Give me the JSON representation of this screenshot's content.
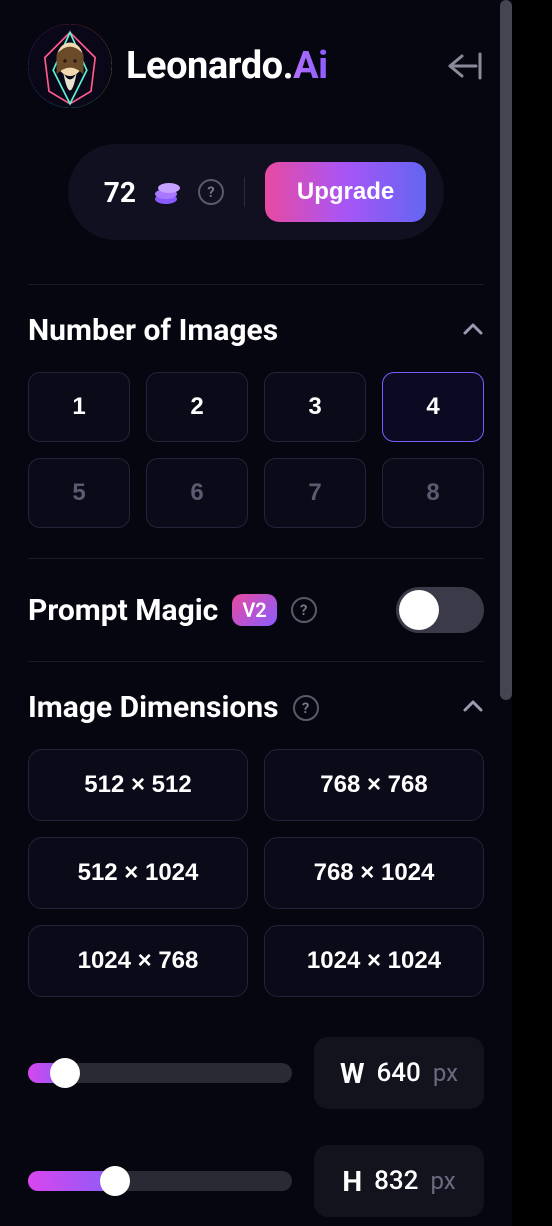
{
  "brand": {
    "name": "Leonardo.",
    "suffix": "Ai"
  },
  "credits": {
    "count": "72",
    "upgrade_label": "Upgrade"
  },
  "sections": {
    "num_images": {
      "title": "Number of Images",
      "options": [
        "1",
        "2",
        "3",
        "4",
        "5",
        "6",
        "7",
        "8"
      ],
      "selected": "4"
    },
    "prompt_magic": {
      "title": "Prompt Magic",
      "badge": "V2",
      "enabled": false
    },
    "dimensions": {
      "title": "Image Dimensions",
      "presets": [
        "512 × 512",
        "768 × 768",
        "512 × 1024",
        "768 × 1024",
        "1024 × 768",
        "1024 × 1024"
      ],
      "width": {
        "letter": "W",
        "value": "640",
        "unit": "px",
        "fill_pct": 14
      },
      "height": {
        "letter": "H",
        "value": "832",
        "unit": "px",
        "fill_pct": 33
      }
    }
  }
}
